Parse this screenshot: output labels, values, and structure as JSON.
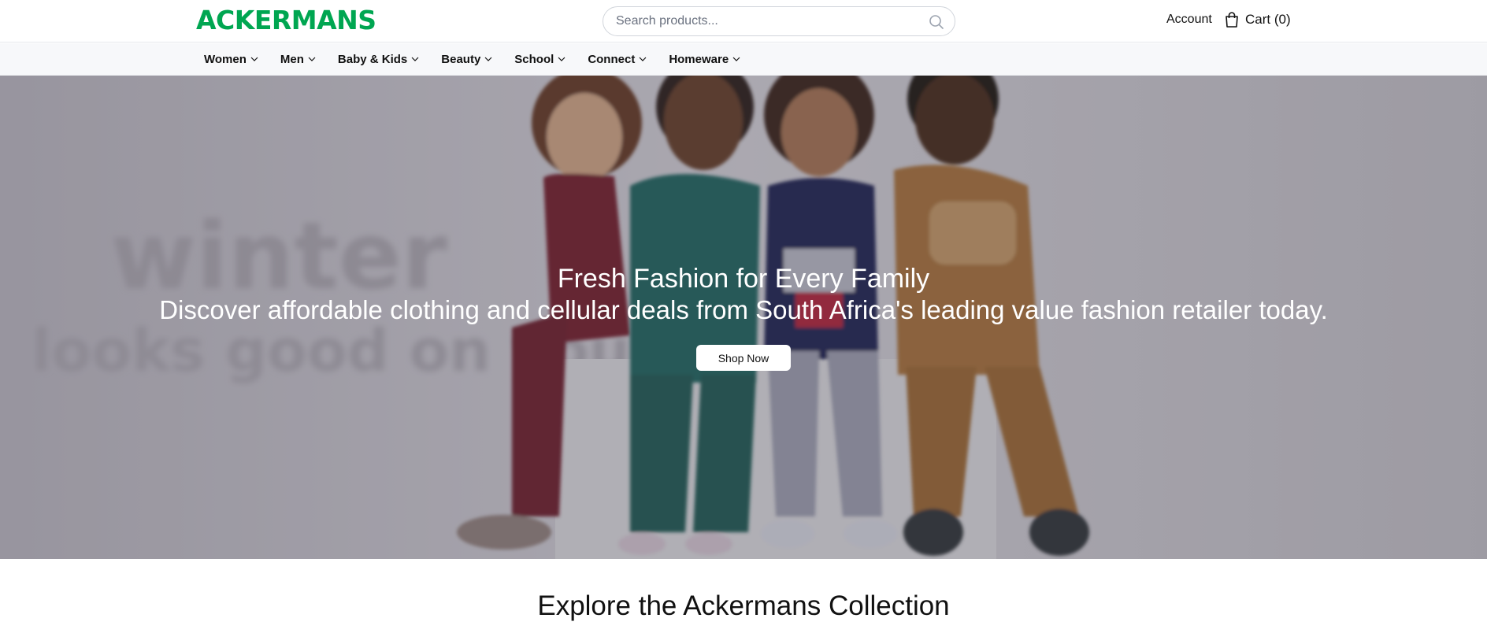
{
  "colors": {
    "brand": "#00a651",
    "header_bg": "#ffffff",
    "nav_bg": "#f7f8fa",
    "hero_overlay": "#3c3846"
  },
  "header": {
    "logo_text": "ACKERMANS",
    "search_placeholder": "Search products...",
    "search_icon": "search-icon",
    "account_label": "Account",
    "cart_icon": "shopping-bag-icon",
    "cart_label": "Cart (0)"
  },
  "nav": {
    "items": [
      {
        "label": "Women"
      },
      {
        "label": "Men"
      },
      {
        "label": "Baby & Kids"
      },
      {
        "label": "Beauty"
      },
      {
        "label": "School"
      },
      {
        "label": "Connect"
      },
      {
        "label": "Homeware"
      }
    ],
    "chevron_icon": "chevron-down-icon"
  },
  "hero": {
    "image_text_line1": "winter",
    "image_text_line2": "looks good on you",
    "title": "Fresh Fashion for Every Family",
    "subtitle": "Discover affordable clothing and cellular deals from South Africa's leading value fashion retailer today.",
    "button_label": "Shop Now"
  },
  "section": {
    "title": "Explore the Ackermans Collection"
  }
}
